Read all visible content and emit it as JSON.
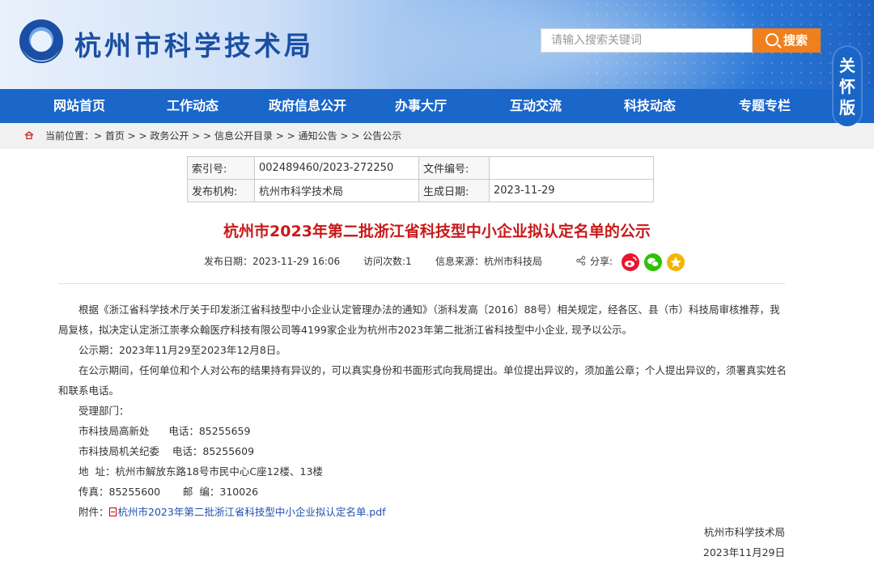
{
  "header": {
    "site_title": "杭州市科学技术局",
    "search_placeholder": "请输入搜索关键词",
    "search_button": "搜索",
    "care_mode": [
      "关",
      "怀",
      "版"
    ]
  },
  "nav": {
    "items": [
      "网站首页",
      "工作动态",
      "政府信息公开",
      "办事大厅",
      "互动交流",
      "科技动态",
      "专题专栏"
    ]
  },
  "breadcrumb": {
    "text": "当前位置：> 首页 > > 政务公开 > > 信息公开目录 > > 通知公告 > > 公告公示"
  },
  "info_table": {
    "index_label": "索引号:",
    "index_value": "002489460/2023-272250",
    "file_no_label": "文件编号:",
    "file_no_value": "",
    "publisher_label": "发布机构:",
    "publisher_value": "杭州市科学技术局",
    "date_label": "生成日期:",
    "date_value": "2023-11-29"
  },
  "article": {
    "title": "杭州市2023年第二批浙江省科技型中小企业拟认定名单的公示",
    "publish_date": "发布日期：2023-11-29 16:06",
    "visits": "访问次数:1",
    "source": "信息来源：杭州市科技局",
    "share_label": "分享:",
    "para1_line1": "根据《浙江省科学技术厅关于印发浙江省科技型中小企业认定管理办法的通知》（浙科发高〔2016〕88号）相关规定，经各区、县（市）科技局审核推荐，我",
    "para1_line2": "局复核，拟决定认定浙江崇孝众翰医疗科技有限公司等4199家企业为杭州市2023年第二批浙江省科技型中小企业, 现予以公示。",
    "period": "公示期：2023年11月29至2023年12月8日。",
    "para3_line1": "在公示期间，任何单位和个人对公布的结果持有异议的，可以真实身份和书面形式向我局提出。单位提出异议的，须加盖公章；个人提出异议的，须署真实姓名",
    "para3_line2": "和联系电话。",
    "dept_label": "受理部门：",
    "dept1": "市科技局高新处      电话：85255659",
    "dept2": "市科技局机关纪委    电话：85255609",
    "address": "地  址：杭州市解放东路18号市民中心C座12楼、13楼",
    "fax": "传真：85255600       邮  编：310026",
    "attach_label": "附件：",
    "attach_name": "杭州市2023年第二批浙江省科技型中小企业拟认定名单.pdf",
    "signer": "杭州市科学技术局",
    "sign_date": "2023年11月29日"
  },
  "colors": {
    "nav_bg": "#1b66c9",
    "title_red": "#c81a1a",
    "search_orange": "#f07f1e",
    "weibo": "#e6162d",
    "wechat": "#2dc100",
    "qzone": "#f5b400"
  }
}
